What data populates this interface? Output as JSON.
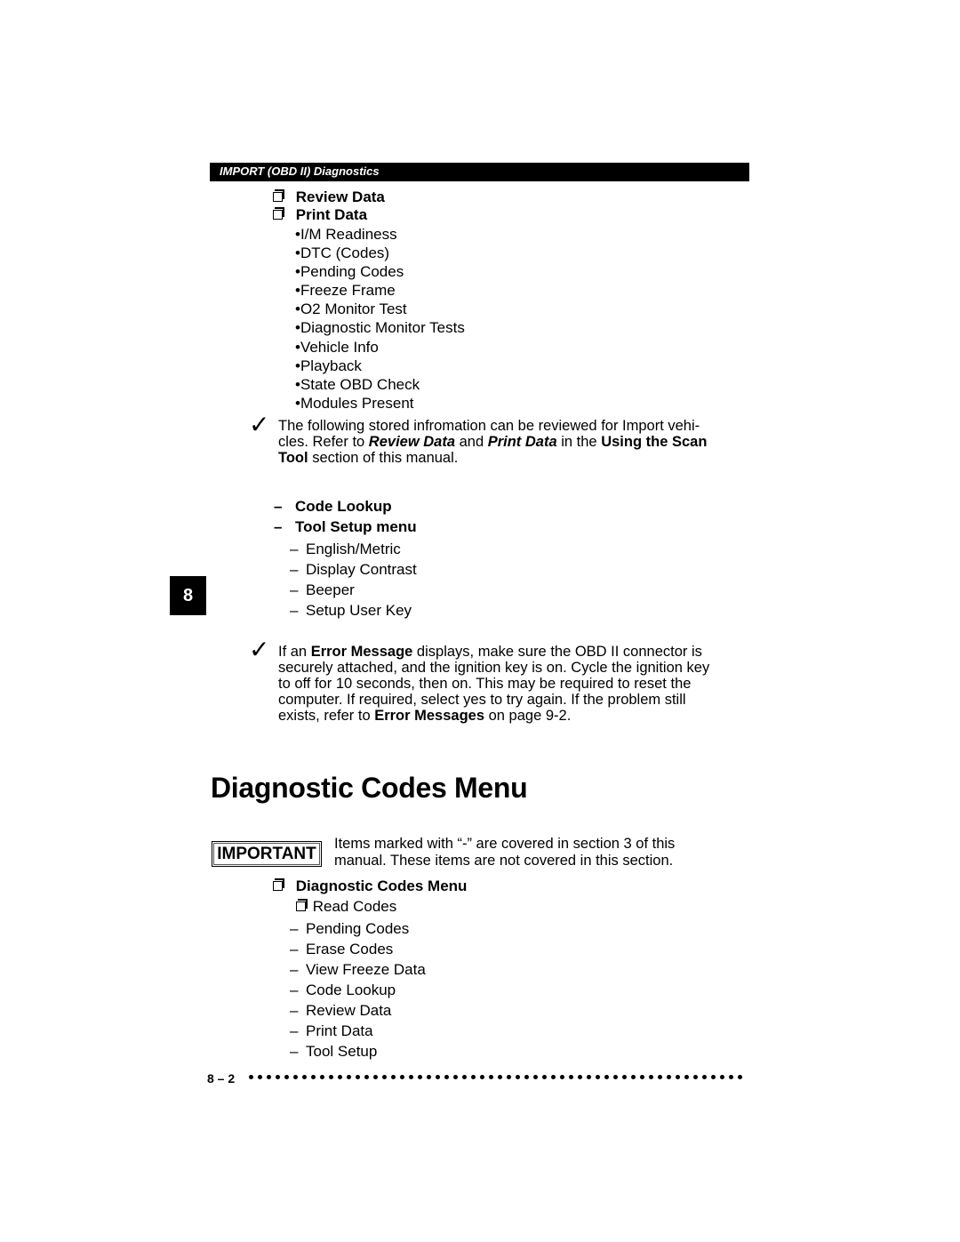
{
  "header": {
    "title": "IMPORT (OBD II) Diagnostics"
  },
  "menu_top": [
    {
      "icon": "checkbox-icon",
      "label": "Review Data"
    },
    {
      "icon": "checkbox-icon",
      "label": "Print Data"
    }
  ],
  "print_data_items": [
    "•I/M Readiness",
    "•DTC (Codes)",
    "•Pending Codes",
    "•Freeze Frame",
    "•O2 Monitor Test",
    "•Diagnostic Monitor Tests",
    "•Vehicle Info",
    "•Playback",
    "•State OBD Check",
    "•Modules Present"
  ],
  "note1": {
    "icon": "checkmark-icon",
    "line1": "The following stored infromation can be reviewed for Import vehi-",
    "line2_pre": "cles. Refer to ",
    "line2_em1": "Review Data",
    "line2_mid": " and ",
    "line2_em2": "Print Data",
    "line2_mid2": " in the ",
    "line2_strong": "Using the Scan",
    "line3_strong": "Tool",
    "line3_post": " section of this manual."
  },
  "menu_mid": [
    {
      "dash": "–",
      "label": "Code Lookup"
    },
    {
      "dash": "–",
      "label": "Tool Setup menu"
    }
  ],
  "tool_setup_items": [
    {
      "dash": "–",
      "label": "English/Metric"
    },
    {
      "dash": "–",
      "label": "Display Contrast"
    },
    {
      "dash": "–",
      "label": "Beeper"
    },
    {
      "dash": "–",
      "label": "Setup User Key"
    }
  ],
  "chapter_tab": "8",
  "note2": {
    "icon": "checkmark-icon",
    "l1_pre": "If an ",
    "l1_strong": "Error Message",
    "l1_post": " displays, make sure the OBD  II connector is",
    "l2": "securely attached, and the ignition key is on. Cycle the ignition key",
    "l3": "to off for 10 seconds, then on. This may be required to reset the",
    "l4": "computer. If required, select yes to try again. If the problem still",
    "l5_pre": "exists, refer to ",
    "l5_strong": "Error Messages",
    "l5_post": " on page 9-2."
  },
  "section": {
    "title": "Diagnostic Codes Menu",
    "important_label": "IMPORTANT",
    "important_line1": "Items marked with “-” are covered in section 3 of this",
    "important_line2": "manual. These items are not covered in this section.",
    "menu_heading": "Diagnostic Codes Menu",
    "read_codes": "Read Codes",
    "items": [
      {
        "dash": "–",
        "label": "Pending Codes"
      },
      {
        "dash": "–",
        "label": "Erase Codes"
      },
      {
        "dash": "–",
        "label": "View Freeze Data"
      },
      {
        "dash": "–",
        "label": "Code Lookup"
      },
      {
        "dash": "–",
        "label": "Review Data"
      },
      {
        "dash": "–",
        "label": "Print Data"
      },
      {
        "dash": "–",
        "label": "Tool Setup"
      }
    ]
  },
  "footer": {
    "page_number": "8 – 2"
  }
}
